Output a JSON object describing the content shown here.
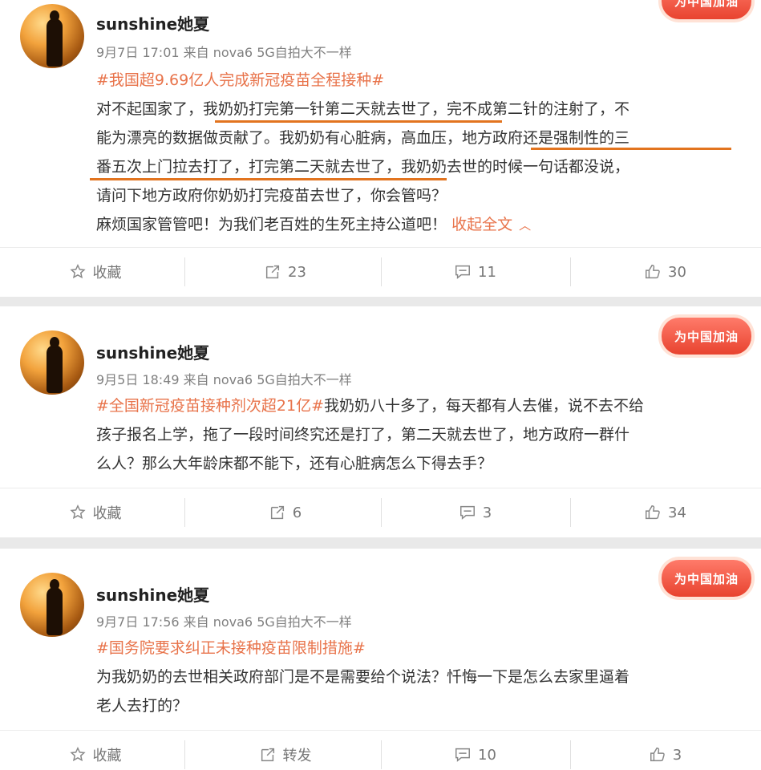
{
  "posts": [
    {
      "username": "sunshine她夏",
      "meta": "9月7日 17:01 来自 nova6 5G自拍大不一样",
      "hashtag": "#我国超9.69亿人完成新冠疫苗全程接种#",
      "lines": [
        "对不起国家了，我奶奶打完第一针第二天就去世了，完不成第二针的注射了，不",
        "能为漂亮的数据做贡献了。我奶奶有心脏病，高血压，地方政府还是强制性的三",
        "番五次上门拉去打了，打完第二天就去世了，我奶奶去世的时候一句话都没说，",
        "请问下地方政府你奶奶打完疫苗去世了，你会管吗？",
        "麻烦国家管管吧！为我们老百姓的生死主持公道吧！"
      ],
      "collapse": "收起全文",
      "collapse_icon": "chevron-up-icon",
      "badge": "为中国加油",
      "actions": {
        "favorite": "收藏",
        "repost": "23",
        "comment": "11",
        "like": "30"
      }
    },
    {
      "username": "sunshine她夏",
      "meta": "9月5日 18:49 来自 nova6 5G自拍大不一样",
      "hashtag": "#全国新冠疫苗接种剂次超21亿#",
      "line1_rest": "我奶奶八十多了，每天都有人去催，说不去不给",
      "lines": [
        "孩子报名上学，拖了一段时间终究还是打了，第二天就去世了，地方政府一群什",
        "么人？那么大年龄床都不能下，还有心脏病怎么下得去手？"
      ],
      "badge": "为中国加油",
      "actions": {
        "favorite": "收藏",
        "repost": "6",
        "comment": "3",
        "like": "34"
      }
    },
    {
      "username": "sunshine她夏",
      "meta": "9月7日 17:56 来自 nova6 5G自拍大不一样",
      "hashtag": "#国务院要求纠正未接种疫苗限制措施#",
      "lines": [
        "为我奶奶的去世相关政府部门是不是需要给个说法？忏悔一下是怎么去家里逼着",
        "老人去打的？"
      ],
      "badge": "为中国加油",
      "actions": {
        "favorite": "收藏",
        "repost": "转发",
        "comment": "10",
        "like": "3"
      }
    }
  ],
  "accent_color": "#e8734a",
  "underline_color": "#e2741f"
}
